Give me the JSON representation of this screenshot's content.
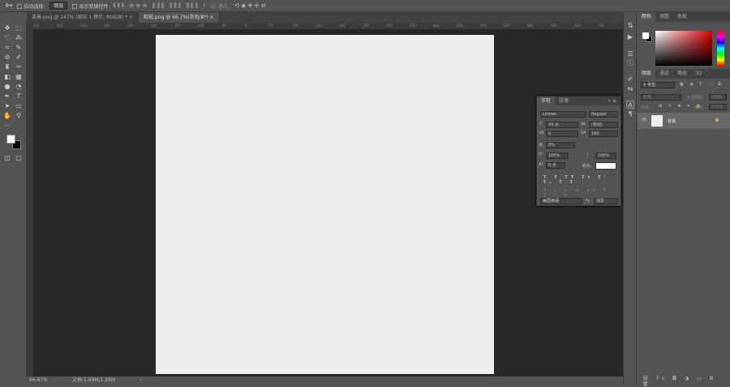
{
  "options_bar": {
    "auto_select_label": "自动选择:",
    "auto_select_value": "图层",
    "show_transform_label": "显示变换控件",
    "mode_3d_label": "3D 模式:"
  },
  "tabs": [
    {
      "label": "背景.png @ 147% (矩形 1 拷贝, RGB/8) *",
      "active": false
    },
    {
      "label": "软纸.png @ 66.7%(灰色/8*)",
      "active": true
    }
  ],
  "ruler_ticks": [
    "450",
    "400",
    "350",
    "300",
    "250",
    "200",
    "150",
    "100",
    "50",
    "0",
    "50",
    "100",
    "150",
    "200",
    "250",
    "300",
    "350",
    "400",
    "450",
    "500",
    "550",
    "600",
    "650",
    "700",
    "750"
  ],
  "status": {
    "zoom": "66.67%",
    "doc": "文档:1.69M/1.69M"
  },
  "color_panel": {
    "tabs": [
      "颜色",
      "调整",
      "色板"
    ]
  },
  "layers_panel": {
    "tabs": [
      "图层",
      "通道",
      "路径",
      "3D"
    ],
    "kind": "类型",
    "blend": "正常",
    "opacity_label": "不透明度:",
    "opacity": "100%",
    "lock_label": "锁定:",
    "fill_label": "填充:",
    "fill": "100%",
    "layers": [
      {
        "name": "背景",
        "locked": true,
        "visible": true
      }
    ]
  },
  "character_panel": {
    "tabs": [
      "字符",
      "段落"
    ],
    "font": "Lintsec",
    "style": "Regular",
    "size": "43 点",
    "leading": "(自动)",
    "kerning": "0",
    "tracking": "180",
    "scale_baseline": "0%",
    "vscale": "100%",
    "hscale": "100%",
    "baseline": "0 点",
    "color_label": "颜色:",
    "language": "美国英语",
    "aa": "浑厚",
    "text_color": "#ffffff"
  }
}
